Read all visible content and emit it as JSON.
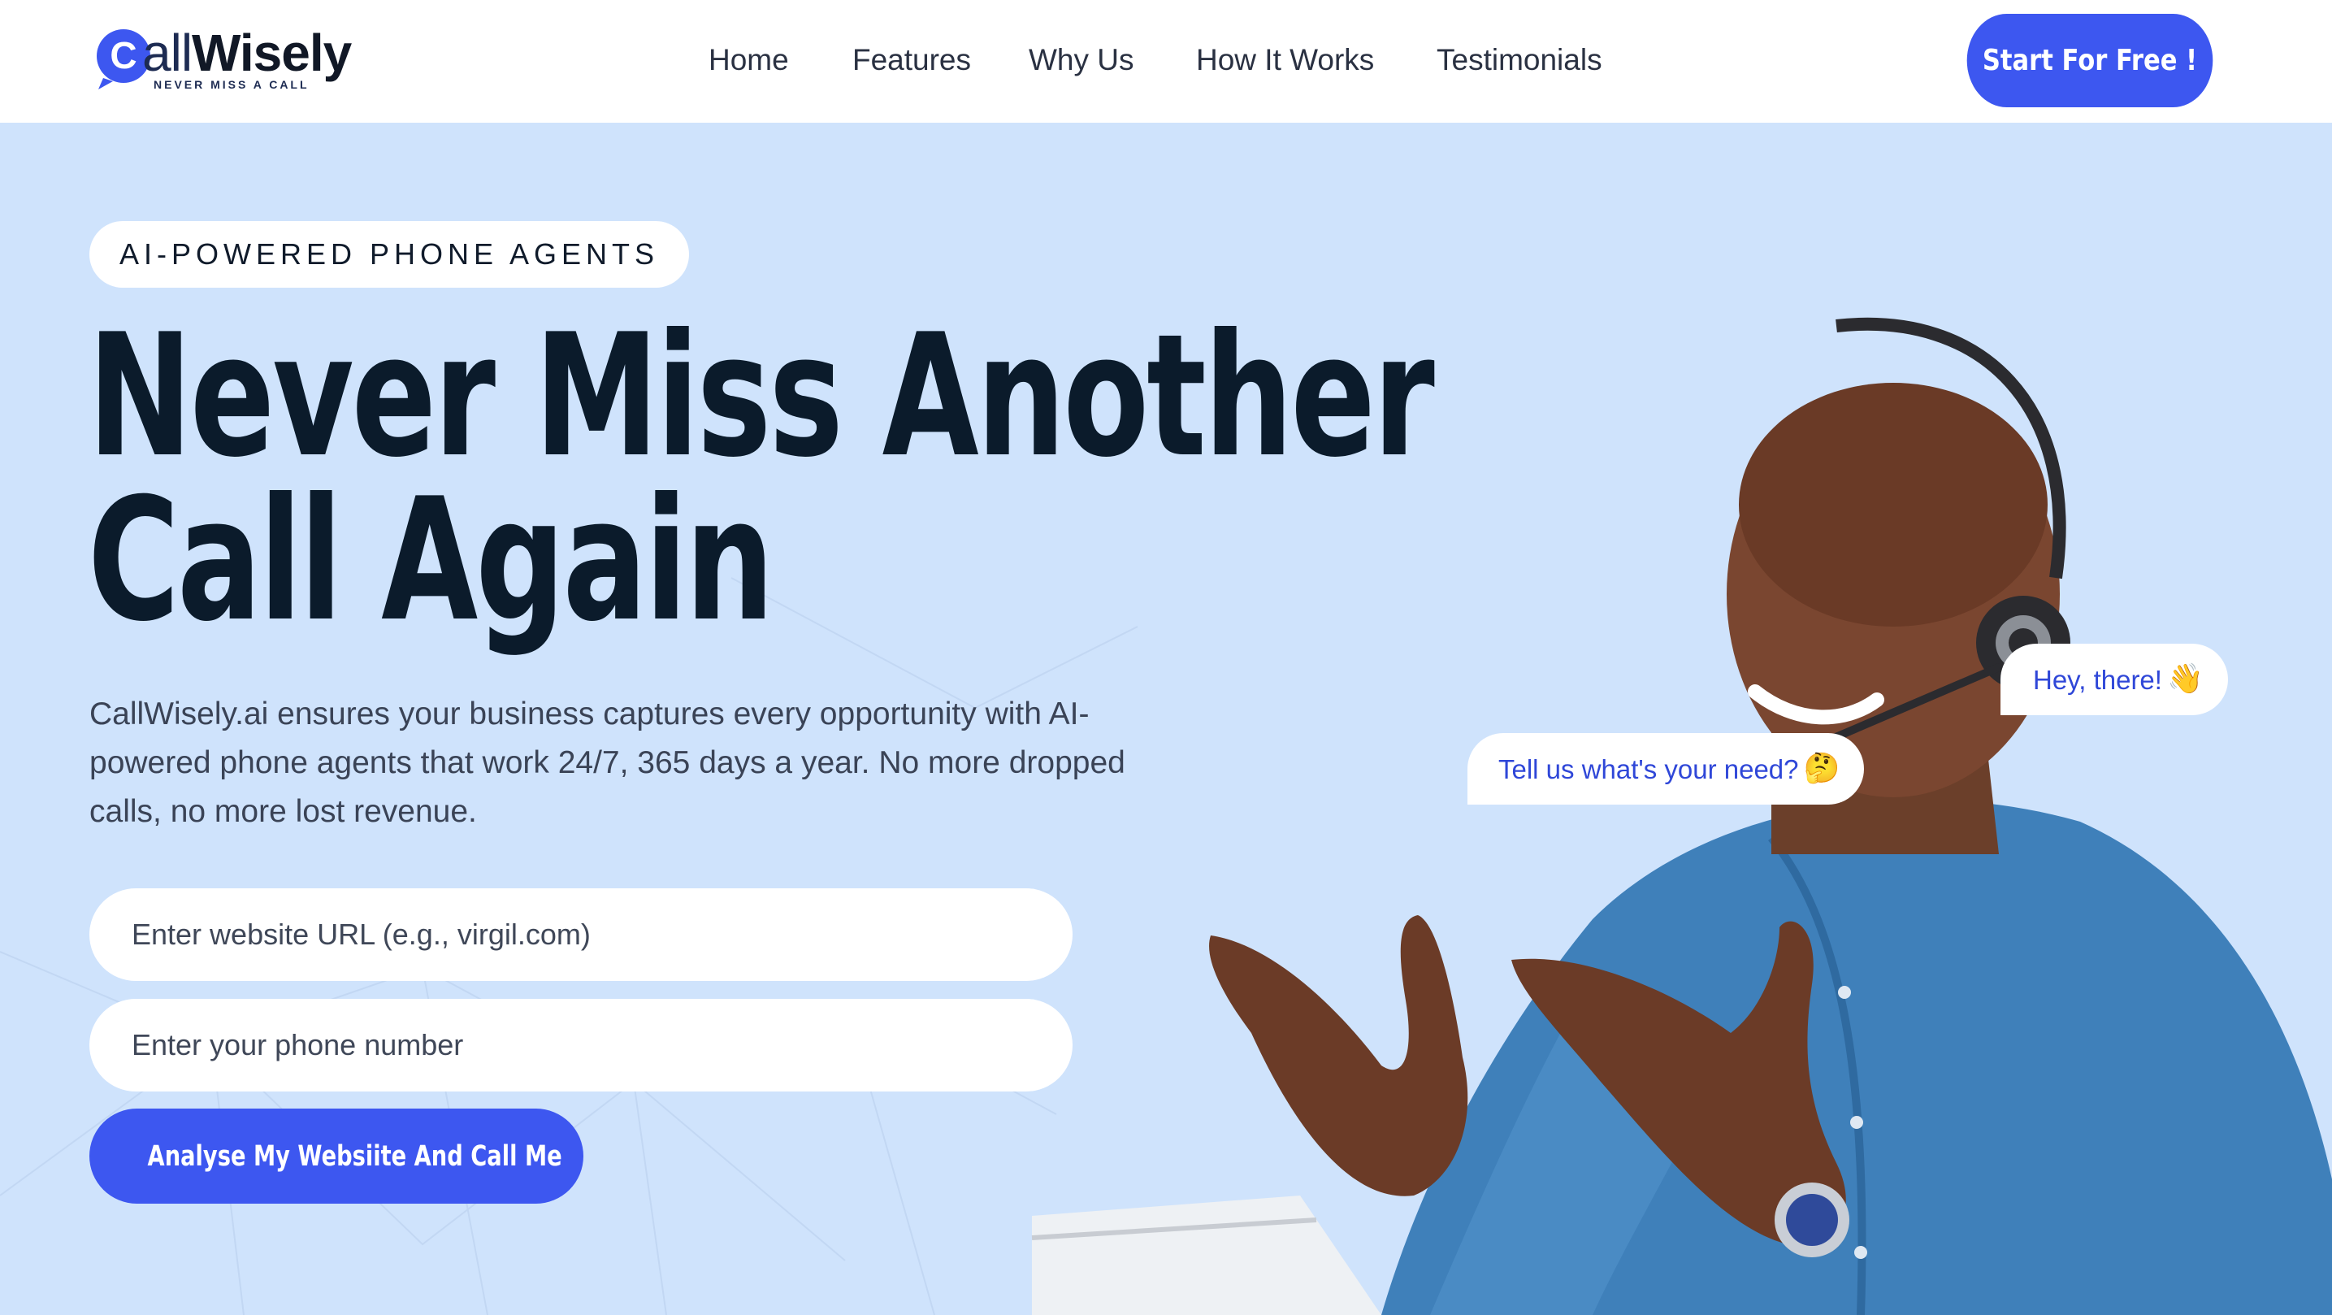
{
  "header": {
    "logo": {
      "word_light": "all",
      "word_bold": "Wisely",
      "tagline": "NEVER MISS A CALL",
      "mark_letter": "C"
    },
    "nav": [
      "Home",
      "Features",
      "Why Us",
      "How It Works",
      "Testimonials"
    ],
    "cta": "Start For Free !"
  },
  "hero": {
    "badge": "AI-POWERED PHONE AGENTS",
    "headline": [
      "Never Miss Another",
      "Call Again"
    ],
    "lead": "CallWisely.ai ensures your business captures every opportunity with AI-powered phone agents that work 24/7, 365 days a year. No more dropped calls, no more lost revenue.",
    "url_placeholder": "Enter website URL (e.g., virgil.com)",
    "phone_placeholder": "Enter your phone number",
    "submit": "Analyse My Websiite And Call Me",
    "bubbles": [
      {
        "text": "Hey, there!",
        "emoji": "👋"
      },
      {
        "text": "Tell us what's your need?",
        "emoji": "🤔"
      }
    ]
  },
  "colors": {
    "accent": "#3d57f0",
    "hero_bg": "#cfe3fc",
    "headline": "#0b1b2b",
    "bubble_text": "#2f47d8"
  }
}
